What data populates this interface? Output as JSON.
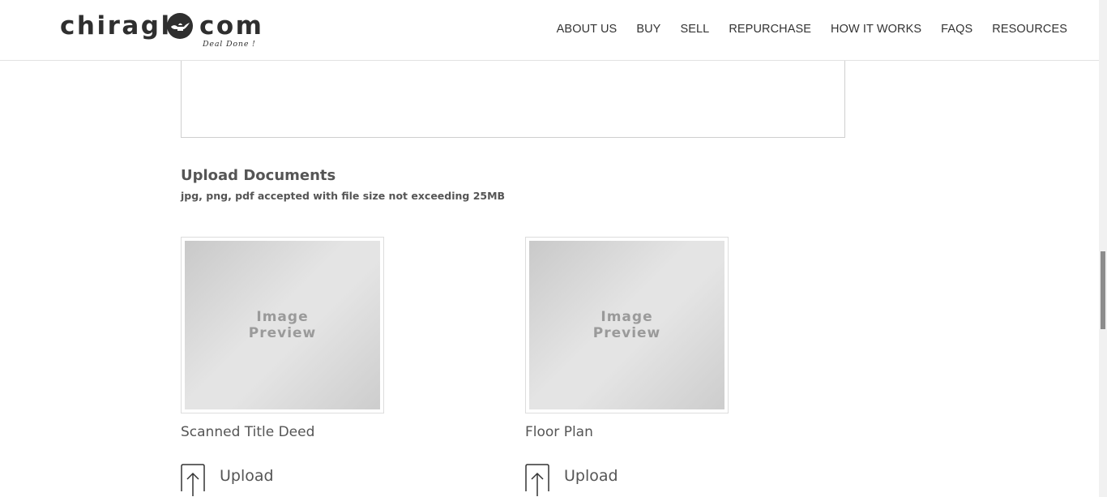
{
  "header": {
    "logo": {
      "left_text": "chiragh",
      "right_text": "com",
      "tagline": "Deal Done !"
    },
    "nav": [
      {
        "label": "ABOUT US"
      },
      {
        "label": "BUY"
      },
      {
        "label": "SELL"
      },
      {
        "label": "REPURCHASE"
      },
      {
        "label": "HOW IT WORKS"
      },
      {
        "label": "FAQS"
      },
      {
        "label": "RESOURCES"
      }
    ]
  },
  "upload": {
    "title": "Upload Documents",
    "subtitle": "jpg, png, pdf accepted with file size not exceeding 25MB",
    "documents": [
      {
        "preview_text": "Image Preview",
        "label": "Scanned Title Deed",
        "button_label": "Upload"
      },
      {
        "preview_text": "Image Preview",
        "label": "Floor Plan",
        "button_label": "Upload"
      }
    ]
  }
}
